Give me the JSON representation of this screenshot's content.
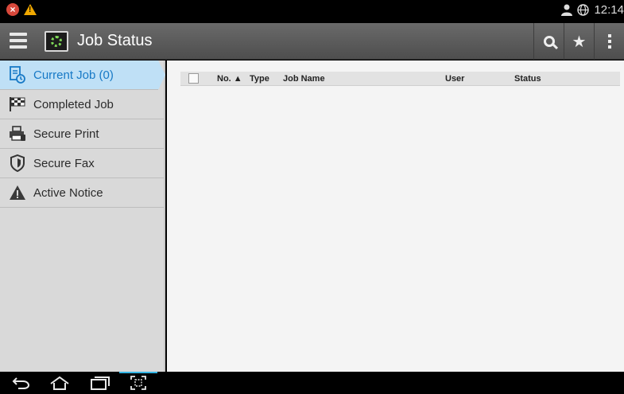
{
  "status_bar": {
    "icons": [
      "error-icon",
      "warning-icon",
      "user-icon",
      "globe-icon"
    ],
    "time": "12:14"
  },
  "app_bar": {
    "title": "Job Status",
    "actions": [
      "search-icon",
      "star-icon",
      "overflow-menu-icon"
    ]
  },
  "sidebar": {
    "items": [
      {
        "label": "Current Job (0)",
        "icon": "current-job-icon",
        "active": true
      },
      {
        "label": "Completed Job",
        "icon": "checkered-flag-icon",
        "active": false
      },
      {
        "label": "Secure Print",
        "icon": "printer-icon",
        "active": false
      },
      {
        "label": "Secure Fax",
        "icon": "shield-icon",
        "active": false
      },
      {
        "label": "Active Notice",
        "icon": "warning-icon",
        "active": false
      }
    ]
  },
  "table": {
    "columns": {
      "no": "No. ▲",
      "type": "Type",
      "job_name": "Job Name",
      "user": "User",
      "status": "Status"
    },
    "rows": []
  },
  "nav_bar": {
    "buttons": [
      "back-icon",
      "home-icon",
      "recent-apps-icon",
      "screenshot-icon"
    ]
  },
  "colors": {
    "accent": "#1779c6",
    "active_bg": "#bfe0f6",
    "appbar": "#5c5c5c",
    "sidebar": "#d9d9d9",
    "error": "#d8483b",
    "warning": "#f0a800"
  }
}
